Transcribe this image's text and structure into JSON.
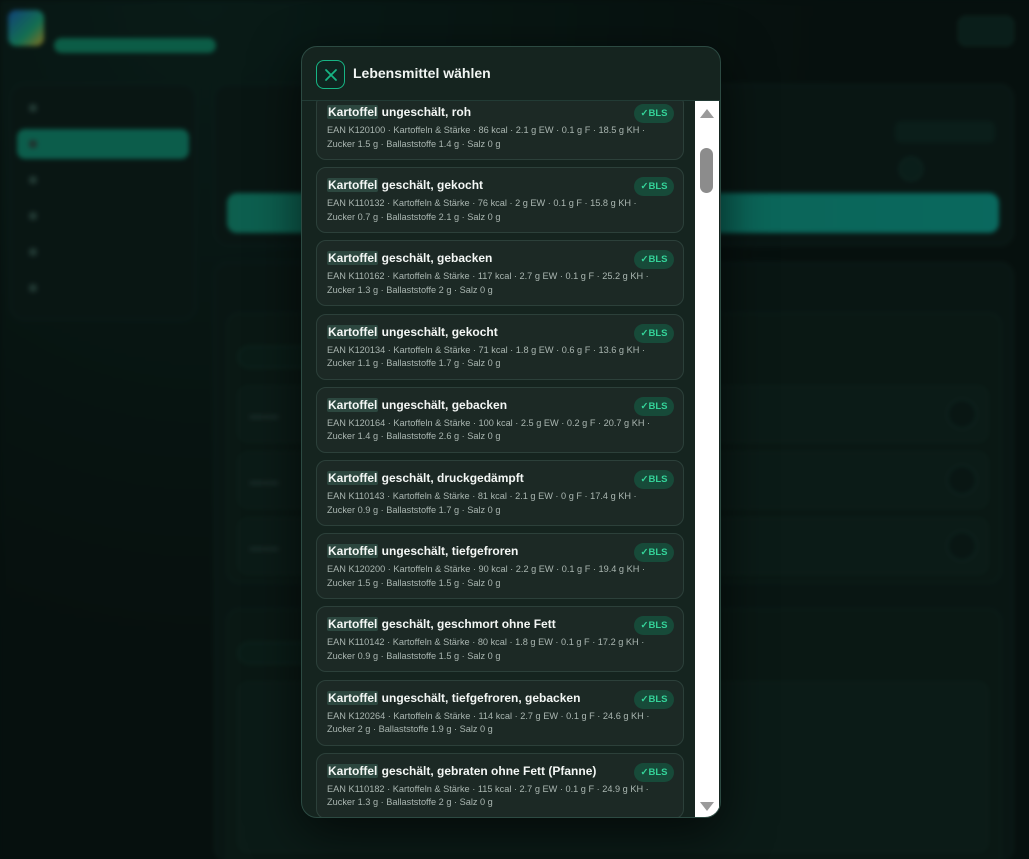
{
  "modal": {
    "title": "Lebensmittel wählen",
    "close_icon": "close-x-icon"
  },
  "foods": [
    {
      "highlight": "Kartoffel",
      "rest": " ungeschält, roh",
      "meta": "EAN K120100 · Kartoffeln & Stärke · 86 kcal · 2.1 g EW · 0.1 g F · 18.5 g KH · Zucker 1.5 g · Ballaststoffe 1.4 g · Salz 0 g",
      "badge": "✓BLS"
    },
    {
      "highlight": "Kartoffel",
      "rest": " geschält, gekocht",
      "meta": "EAN K110132 · Kartoffeln & Stärke · 76 kcal · 2 g EW · 0.1 g F · 15.8 g KH · Zucker 0.7 g · Ballaststoffe 2.1 g · Salz 0 g",
      "badge": "✓BLS"
    },
    {
      "highlight": "Kartoffel",
      "rest": " geschält, gebacken",
      "meta": "EAN K110162 · Kartoffeln & Stärke · 117 kcal · 2.7 g EW · 0.1 g F · 25.2 g KH · Zucker 1.3 g · Ballaststoffe 2 g · Salz 0 g",
      "badge": "✓BLS"
    },
    {
      "highlight": "Kartoffel",
      "rest": " ungeschält, gekocht",
      "meta": "EAN K120134 · Kartoffeln & Stärke · 71 kcal · 1.8 g EW · 0.6 g F · 13.6 g KH · Zucker 1.1 g · Ballaststoffe 1.7 g · Salz 0 g",
      "badge": "✓BLS"
    },
    {
      "highlight": "Kartoffel",
      "rest": " ungeschält, gebacken",
      "meta": "EAN K120164 · Kartoffeln & Stärke · 100 kcal · 2.5 g EW · 0.2 g F · 20.7 g KH · Zucker 1.4 g · Ballaststoffe 2.6 g · Salz 0 g",
      "badge": "✓BLS"
    },
    {
      "highlight": "Kartoffel",
      "rest": " geschält, druckgedämpft",
      "meta": "EAN K110143 · Kartoffeln & Stärke · 81 kcal · 2.1 g EW · 0 g F · 17.4 g KH · Zucker 0.9 g · Ballaststoffe 1.7 g · Salz 0 g",
      "badge": "✓BLS"
    },
    {
      "highlight": "Kartoffel",
      "rest": " ungeschält, tiefgefroren",
      "meta": "EAN K120200 · Kartoffeln & Stärke · 90 kcal · 2.2 g EW · 0.1 g F · 19.4 g KH · Zucker 1.5 g · Ballaststoffe 1.5 g · Salz 0 g",
      "badge": "✓BLS"
    },
    {
      "highlight": "Kartoffel",
      "rest": " geschält, geschmort ohne Fett",
      "meta": "EAN K110142 · Kartoffeln & Stärke · 80 kcal · 1.8 g EW · 0.1 g F · 17.2 g KH · Zucker 0.9 g · Ballaststoffe 1.5 g · Salz 0 g",
      "badge": "✓BLS"
    },
    {
      "highlight": "Kartoffel",
      "rest": " ungeschält, tiefgefroren, gebacken",
      "meta": "EAN K120264 · Kartoffeln & Stärke · 114 kcal · 2.7 g EW · 0.1 g F · 24.6 g KH · Zucker 2 g · Ballaststoffe 1.9 g · Salz 0 g",
      "badge": "✓BLS"
    },
    {
      "highlight": "Kartoffel",
      "rest": " geschält, gebraten ohne Fett (Pfanne)",
      "meta": "EAN K110182 · Kartoffeln & Stärke · 115 kcal · 2.7 g EW · 0.1 g F · 24.9 g KH · Zucker 1.3 g · Ballaststoffe 2 g · Salz 0 g",
      "badge": "✓BLS"
    }
  ],
  "scrollbar": {
    "position": 0.07
  },
  "colors": {
    "accent": "#17b584",
    "badge_text": "#34d399",
    "badge_bg": "#174a39",
    "modal_bg": "#15241f",
    "card_bg": "#1c2925"
  }
}
